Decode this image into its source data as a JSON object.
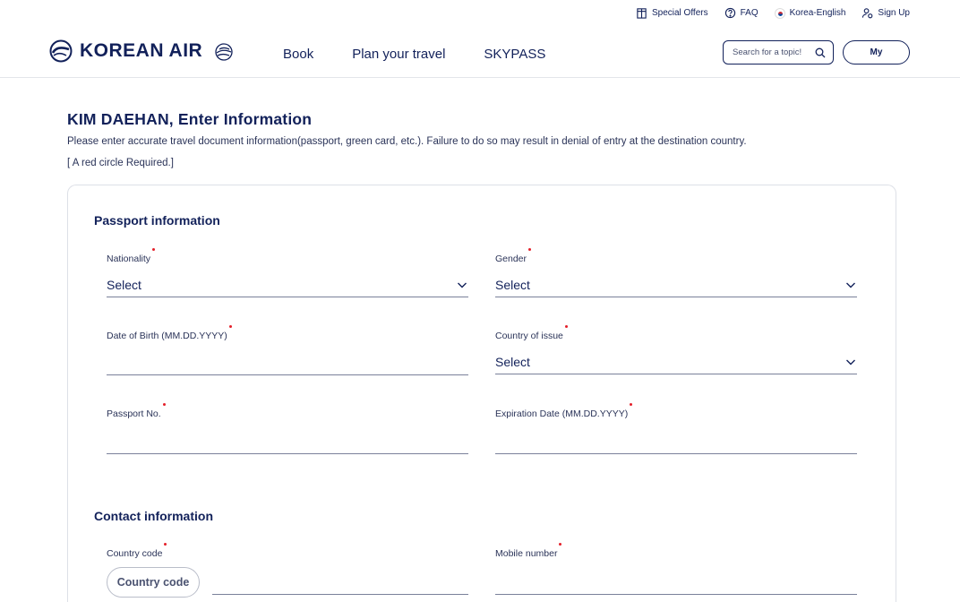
{
  "util_bar": {
    "special_offers": "Special Offers",
    "faq": "FAQ",
    "language": "Korea-English",
    "sign_up": "Sign Up"
  },
  "header": {
    "logo_text": "KOREAN AIR",
    "nav": [
      "Book",
      "Plan your travel",
      "SKYPASS"
    ],
    "search_placeholder": "Search for a topic!",
    "my_label": "My"
  },
  "page": {
    "title": "KIM DAEHAN, Enter Information",
    "description": "Please enter accurate travel document information(passport, green card, etc.). Failure to do so may result in denial of entry at the destination country.",
    "note": "[ A red circle Required.]"
  },
  "passport": {
    "section_title": "Passport information",
    "nationality": {
      "label": "Nationality",
      "value": "Select"
    },
    "gender": {
      "label": "Gender",
      "value": "Select"
    },
    "dob": {
      "label": "Date of Birth (MM.DD.YYYY)",
      "value": ""
    },
    "country_of_issue": {
      "label": "Country of issue",
      "value": "Select"
    },
    "passport_no": {
      "label": "Passport No.",
      "value": ""
    },
    "expiration": {
      "label": "Expiration Date (MM.DD.YYYY)",
      "value": ""
    }
  },
  "contact": {
    "section_title": "Contact information",
    "country_code": {
      "label": "Country code",
      "button": "Country code",
      "value": ""
    },
    "mobile": {
      "label": "Mobile number",
      "value": ""
    }
  },
  "colors": {
    "brand_navy": "#12215a",
    "required_red": "#e4202a",
    "border": "#dde0e7"
  }
}
